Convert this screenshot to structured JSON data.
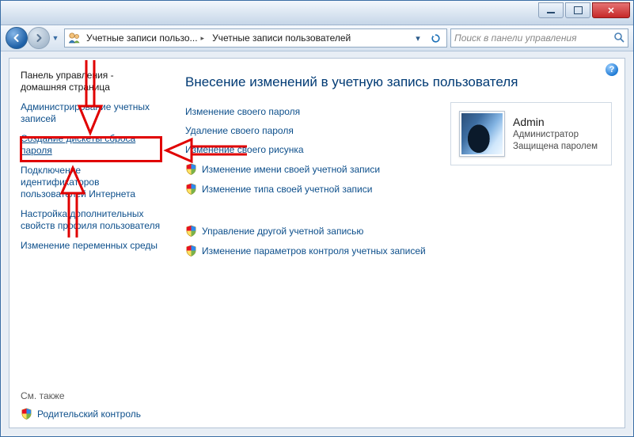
{
  "breadcrumb": {
    "item1": "Учетные записи пользо...",
    "item2": "Учетные записи пользователей"
  },
  "search": {
    "placeholder": "Поиск в панели управления"
  },
  "heading": "Внесение изменений в учетную запись пользователя",
  "sidebar": {
    "home": "Панель управления - домашняя страница",
    "items": [
      "Администрирование учетных записей",
      "Создание дискеты сброса пароля",
      "Подключение идентификаторов пользователей Интернета",
      "Настройка дополнительных свойств профиля пользователя",
      "Изменение переменных среды"
    ],
    "see_also": "См. также",
    "parental": "Родительский контроль"
  },
  "tasks": [
    "Изменение своего пароля",
    "Удаление своего пароля",
    "Изменение своего рисунка",
    "Изменение имени своей учетной записи",
    "Изменение типа своей учетной записи",
    "Управление другой учетной записью",
    "Изменение параметров контроля учетных записей"
  ],
  "user": {
    "name": "Admin",
    "role": "Администратор",
    "status": "Защищена паролем"
  }
}
